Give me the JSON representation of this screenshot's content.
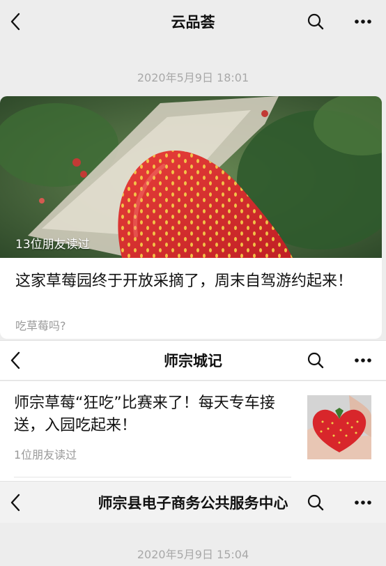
{
  "nav1": {
    "title": "云品荟",
    "back_icon": "chevron-left-icon",
    "search_icon": "search-icon",
    "more_icon": "more-icon"
  },
  "timestamp1": "2020年5月9日 18:01",
  "card1": {
    "read_count": "13位朋友读过",
    "title": "这家草莓园终于开放采摘了，周末自驾游约起来！",
    "subtitle": "吃草莓吗?",
    "image": "strawberry-field-photo"
  },
  "nav2": {
    "title": "师宗城记",
    "back_icon": "chevron-left-icon",
    "search_icon": "search-icon",
    "more_icon": "more-icon"
  },
  "article2": {
    "title": "师宗草莓“狂吃”比赛来了！每天专车接送，入园吃起来！",
    "read_count": "1位朋友读过",
    "image": "heart-strawberry-photo"
  },
  "nav3": {
    "title": "师宗县电子商务公共服务中心",
    "back_icon": "chevron-left-icon",
    "search_icon": "search-icon",
    "more_icon": "more-icon"
  },
  "timestamp2": "2020年5月9日 15:04",
  "colors": {
    "background": "#ededed",
    "card": "#ffffff",
    "muted_text": "#999999",
    "strawberry": "#d8262b"
  }
}
